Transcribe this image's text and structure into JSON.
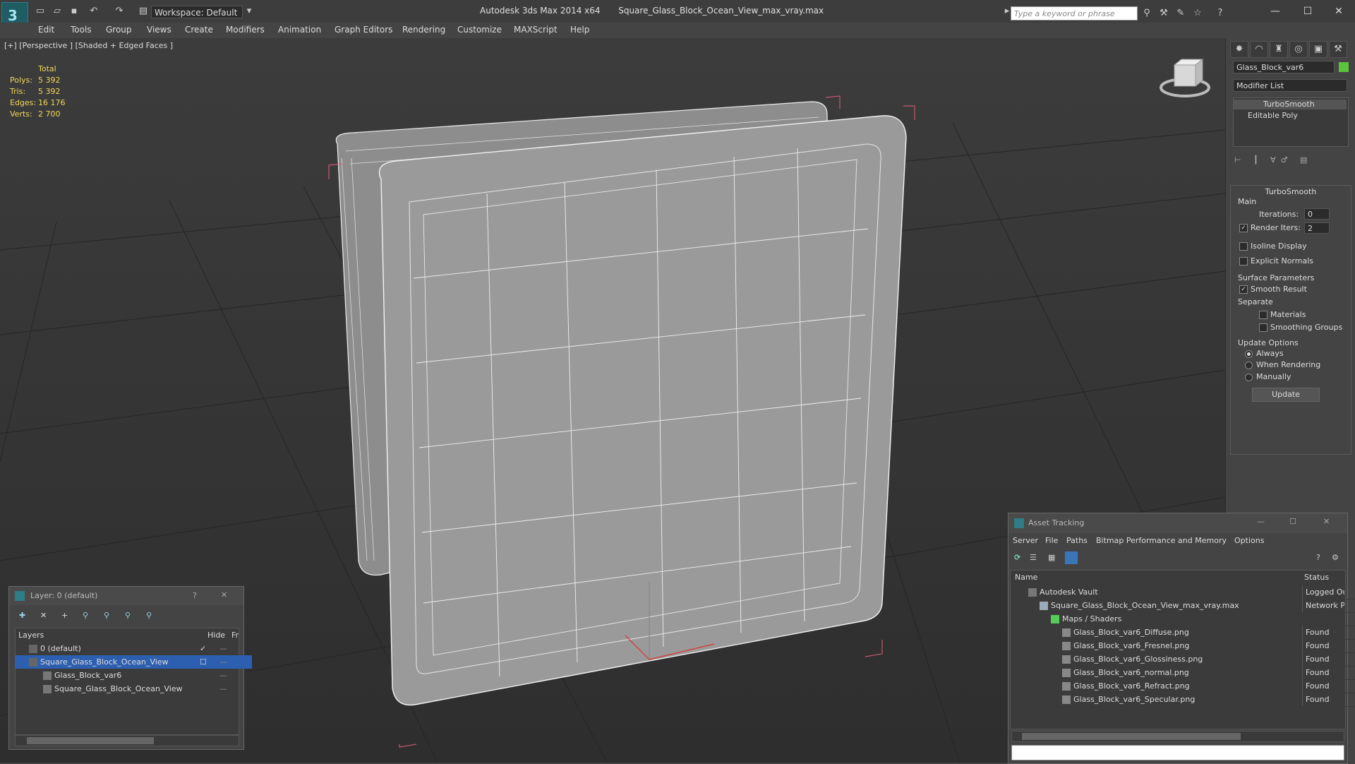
{
  "titlebar": {
    "workspace": "Workspace: Default",
    "app_title": "Autodesk 3ds Max  2014 x64",
    "file_title": "Square_Glass_Block_Ocean_View_max_vray.max",
    "search_placeholder": "Type a keyword or phrase"
  },
  "menu": [
    "Edit",
    "Tools",
    "Group",
    "Views",
    "Create",
    "Modifiers",
    "Animation",
    "Graph Editors",
    "Rendering",
    "Customize",
    "MAXScript",
    "Help"
  ],
  "viewport": {
    "label": "[+] [Perspective ] [Shaded + Edged Faces ]",
    "stats": {
      "header": "Total",
      "rows": [
        {
          "label": "Polys:",
          "value": "5 392"
        },
        {
          "label": "Tris:",
          "value": "5 392"
        },
        {
          "label": "Edges:",
          "value": "16 176"
        },
        {
          "label": "Verts:",
          "value": "2 700"
        }
      ]
    }
  },
  "cmdpanel": {
    "object_name": "Glass_Block_var6",
    "object_color": "#5cc33c",
    "modifier_list": "Modifier List",
    "stack": [
      "TurboSmooth",
      "Editable Poly"
    ],
    "rollout_title": "TurboSmooth",
    "main_label": "Main",
    "iterations_label": "Iterations:",
    "iterations_value": "0",
    "render_iters_label": "Render Iters:",
    "render_iters_value": "2",
    "isoline": "Isoline Display",
    "explicit": "Explicit Normals",
    "surface_params": "Surface Parameters",
    "smooth_result": "Smooth Result",
    "separate": "Separate",
    "materials": "Materials",
    "smoothing_groups": "Smoothing Groups",
    "update_options": "Update Options",
    "always": "Always",
    "when_rendering": "When Rendering",
    "manually": "Manually",
    "update_btn": "Update"
  },
  "asset": {
    "title": "Asset Tracking",
    "menu": [
      "Server",
      "File",
      "Paths",
      "Bitmap Performance and Memory",
      "Options"
    ],
    "col_name": "Name",
    "col_status": "Status",
    "rows": [
      {
        "name": "Autodesk Vault",
        "status": "Logged Out"
      },
      {
        "name": "Square_Glass_Block_Ocean_View_max_vray.max",
        "status": "Network Pa"
      },
      {
        "name": "Maps / Shaders",
        "status": ""
      },
      {
        "name": "Glass_Block_var6_Diffuse.png",
        "status": "Found"
      },
      {
        "name": "Glass_Block_var6_Fresnel.png",
        "status": "Found"
      },
      {
        "name": "Glass_Block_var6_Glossiness.png",
        "status": "Found"
      },
      {
        "name": "Glass_Block_var6_normal.png",
        "status": "Found"
      },
      {
        "name": "Glass_Block_var6_Refract.png",
        "status": "Found"
      },
      {
        "name": "Glass_Block_var6_Specular.png",
        "status": "Found"
      }
    ]
  },
  "layer": {
    "title": "Layer: 0 (default)",
    "help": "?",
    "col_layers": "Layers",
    "col_hide": "Hide",
    "col_f": "Fr",
    "rows": [
      "0 (default)",
      "Square_Glass_Block_Ocean_View",
      "Glass_Block_var6",
      "Square_Glass_Block_Ocean_View"
    ]
  }
}
